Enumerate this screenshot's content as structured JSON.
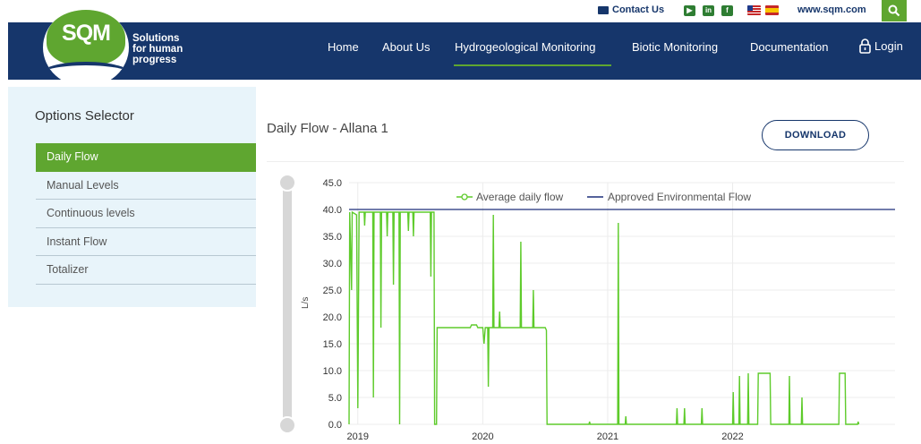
{
  "utility": {
    "contact": "Contact Us",
    "social": [
      "youtube-icon",
      "linkedin-icon",
      "facebook-icon"
    ],
    "website": "www.sqm.com"
  },
  "brand": {
    "logo_text": "SQM",
    "tagline": [
      "Solutions",
      "for human",
      "progress"
    ],
    "green": "#5fa630",
    "navy": "#16366b"
  },
  "nav": {
    "items": [
      "Home",
      "About Us",
      "Hydrogeological Monitoring",
      "Biotic Monitoring",
      "Documentation"
    ],
    "active": "Hydrogeological Monitoring",
    "login": "Login"
  },
  "sidebar": {
    "title": "Options Selector",
    "options": [
      "Daily Flow",
      "Manual Levels",
      "Continuous levels",
      "Instant Flow",
      "Totalizer"
    ],
    "active": "Daily Flow"
  },
  "main": {
    "title": "Daily Flow - Allana 1",
    "download": "DOWNLOAD"
  },
  "chart_data": {
    "type": "line",
    "ylabel": "L/s",
    "ylim": [
      0,
      45
    ],
    "yticks": [
      "0.0",
      "5.0",
      "10.0",
      "15.0",
      "20.0",
      "25.0",
      "30.0",
      "35.0",
      "40.0",
      "45.0"
    ],
    "xticks": [
      "2019",
      "2020",
      "2021",
      "2022"
    ],
    "xlim": [
      2018.93,
      2023.3
    ],
    "grid": true,
    "legend_position": "top",
    "series": [
      {
        "name": "Average daily flow",
        "color": "#5ecb2b",
        "points": [
          [
            2018.93,
            0
          ],
          [
            2018.935,
            39.5
          ],
          [
            2018.95,
            25
          ],
          [
            2018.955,
            39.5
          ],
          [
            2018.99,
            39
          ],
          [
            2019.0,
            3
          ],
          [
            2019.01,
            39.5
          ],
          [
            2019.05,
            39.5
          ],
          [
            2019.055,
            37
          ],
          [
            2019.06,
            39.5
          ],
          [
            2019.12,
            39.5
          ],
          [
            2019.125,
            5
          ],
          [
            2019.13,
            39.5
          ],
          [
            2019.18,
            39.5
          ],
          [
            2019.185,
            18
          ],
          [
            2019.19,
            39.5
          ],
          [
            2019.23,
            39.5
          ],
          [
            2019.235,
            35
          ],
          [
            2019.24,
            39.5
          ],
          [
            2019.28,
            39.5
          ],
          [
            2019.285,
            26
          ],
          [
            2019.29,
            39.5
          ],
          [
            2019.33,
            39.5
          ],
          [
            2019.335,
            0
          ],
          [
            2019.34,
            39.5
          ],
          [
            2019.4,
            39.5
          ],
          [
            2019.405,
            36
          ],
          [
            2019.41,
            39.5
          ],
          [
            2019.44,
            39.5
          ],
          [
            2019.445,
            35
          ],
          [
            2019.45,
            39.5
          ],
          [
            2019.58,
            39.5
          ],
          [
            2019.585,
            27.5
          ],
          [
            2019.59,
            39.5
          ],
          [
            2019.61,
            39.5
          ],
          [
            2019.615,
            0
          ],
          [
            2019.63,
            0
          ],
          [
            2019.635,
            18
          ],
          [
            2019.9,
            18
          ],
          [
            2019.91,
            18.5
          ],
          [
            2019.95,
            18.5
          ],
          [
            2019.96,
            18
          ],
          [
            2020.0,
            18
          ],
          [
            2020.01,
            15
          ],
          [
            2020.02,
            18
          ],
          [
            2020.04,
            18
          ],
          [
            2020.045,
            7
          ],
          [
            2020.05,
            18
          ],
          [
            2020.08,
            18
          ],
          [
            2020.085,
            39
          ],
          [
            2020.09,
            18
          ],
          [
            2020.13,
            18
          ],
          [
            2020.135,
            21
          ],
          [
            2020.14,
            18
          ],
          [
            2020.3,
            18
          ],
          [
            2020.305,
            34
          ],
          [
            2020.31,
            18
          ],
          [
            2020.4,
            18
          ],
          [
            2020.405,
            25
          ],
          [
            2020.41,
            18
          ],
          [
            2020.5,
            18
          ],
          [
            2020.51,
            17.5
          ],
          [
            2020.515,
            0
          ],
          [
            2020.85,
            0
          ],
          [
            2020.855,
            0.5
          ],
          [
            2020.86,
            0
          ],
          [
            2021.08,
            0
          ],
          [
            2021.085,
            37.5
          ],
          [
            2021.09,
            0
          ],
          [
            2021.14,
            0
          ],
          [
            2021.145,
            1.5
          ],
          [
            2021.15,
            0
          ],
          [
            2021.55,
            0
          ],
          [
            2021.555,
            3
          ],
          [
            2021.56,
            0
          ],
          [
            2021.61,
            0
          ],
          [
            2021.615,
            3
          ],
          [
            2021.62,
            0
          ],
          [
            2021.75,
            0
          ],
          [
            2021.755,
            3
          ],
          [
            2021.76,
            0
          ],
          [
            2022.0,
            0
          ],
          [
            2022.005,
            6
          ],
          [
            2022.01,
            0
          ],
          [
            2022.05,
            0
          ],
          [
            2022.055,
            9
          ],
          [
            2022.06,
            0
          ],
          [
            2022.12,
            0
          ],
          [
            2022.125,
            9.5
          ],
          [
            2022.13,
            0
          ],
          [
            2022.2,
            0
          ],
          [
            2022.205,
            9.5
          ],
          [
            2022.3,
            9.5
          ],
          [
            2022.305,
            0
          ],
          [
            2022.45,
            0
          ],
          [
            2022.455,
            9
          ],
          [
            2022.46,
            0
          ],
          [
            2022.55,
            0
          ],
          [
            2022.555,
            5
          ],
          [
            2022.56,
            0
          ],
          [
            2022.85,
            0
          ],
          [
            2022.855,
            9.5
          ],
          [
            2022.9,
            9.5
          ],
          [
            2022.905,
            0
          ],
          [
            2023.0,
            0
          ],
          [
            2023.005,
            0.5
          ],
          [
            2023.01,
            0
          ]
        ]
      },
      {
        "name": "Approved Environmental Flow",
        "color": "#1d2f7a",
        "points": [
          [
            2018.93,
            40
          ],
          [
            2023.3,
            40
          ]
        ]
      }
    ]
  }
}
